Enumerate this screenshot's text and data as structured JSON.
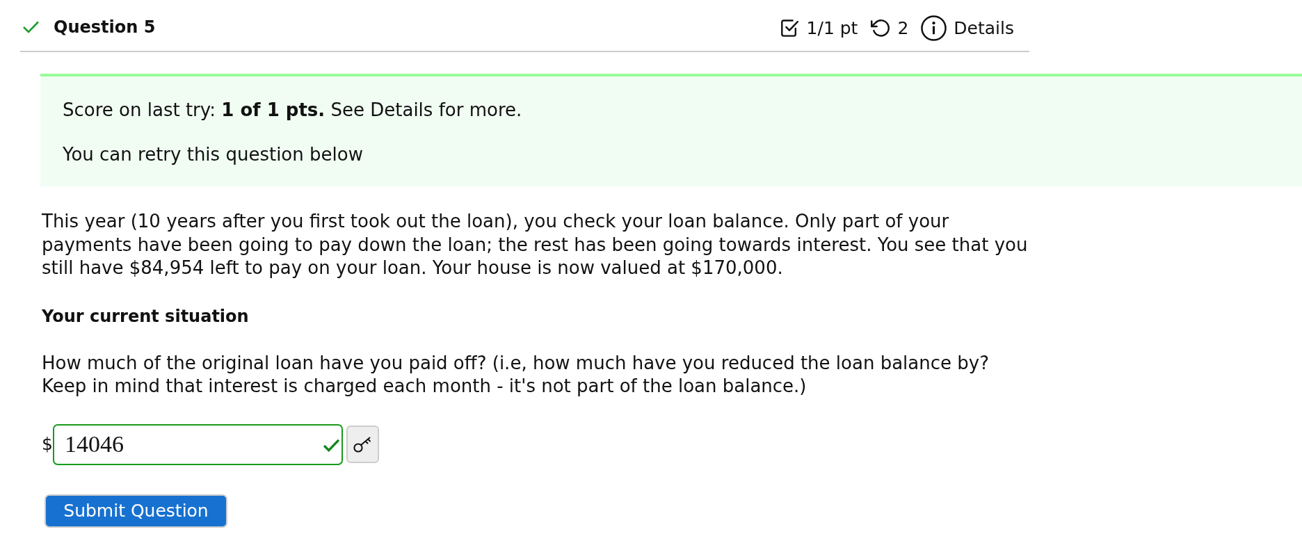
{
  "question": {
    "correct": true,
    "title": "Question 5",
    "score": "1/1 pt",
    "tries": "2",
    "details": "Details"
  },
  "feedback": {
    "lines": [
      "Score on last try: **1 of 1 pts.** See Details for more.",
      "You can retry this question below"
    ]
  },
  "content": [
    {
      "kind": "paragraph",
      "text": "This year (10 years after you first took out the loan), you check your loan balance. Only part of your payments have been going to pay down the loan; the rest has been going towards interest. You see that you still have $84,954 left to pay on your loan. Your house is now valued at $170,000."
    },
    {
      "kind": "heading",
      "text": "Your current situation"
    },
    {
      "kind": "paragraph",
      "text": "How much of the original loan have you paid off? (i.e, how much have you reduced the loan balance by? Keep in mind that interest is charged each month - it's not part of the loan balance.)"
    }
  ],
  "answer": {
    "prefix": "$",
    "value": "14046",
    "correct": true
  },
  "submit_button": {
    "label": "Submit Question"
  }
}
